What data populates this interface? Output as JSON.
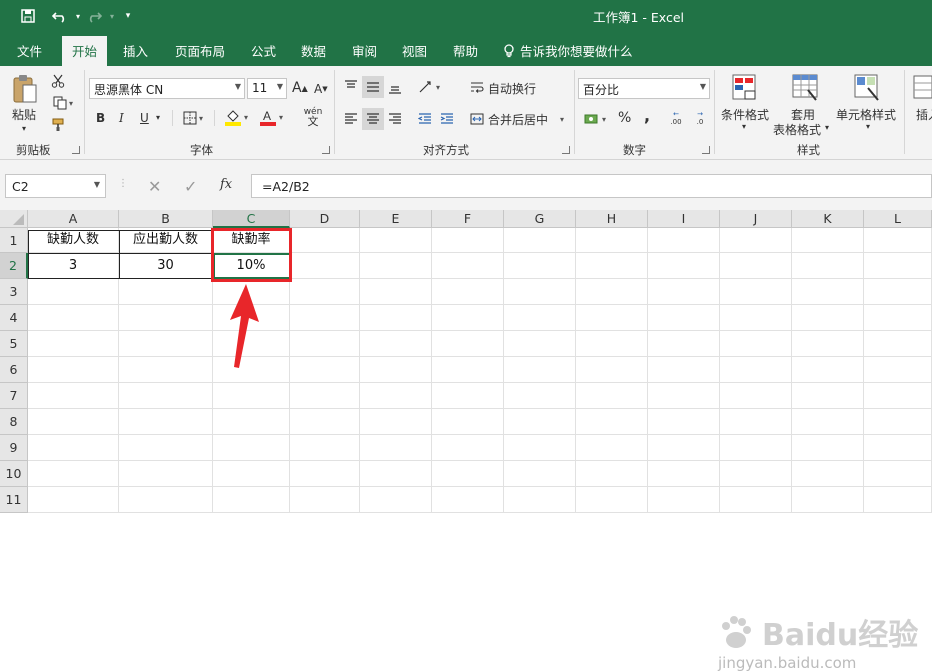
{
  "title": "工作簿1  -  Excel",
  "tabs": [
    "文件",
    "开始",
    "插入",
    "页面布局",
    "公式",
    "数据",
    "审阅",
    "视图",
    "帮助"
  ],
  "active_tab": "开始",
  "tell_me": "告诉我你想要做什么",
  "ribbon": {
    "clipboard": {
      "paste_label": "粘贴",
      "group_label": "剪贴板"
    },
    "font": {
      "font_name": "思源黑体 CN",
      "font_size": "11",
      "bold": "B",
      "italic": "I",
      "underline": "U",
      "grow": "A",
      "shrink": "A",
      "wen": "wén",
      "group_label": "字体"
    },
    "alignment": {
      "wrap_text": "自动换行",
      "merge_center": "合并后居中",
      "group_label": "对齐方式"
    },
    "number": {
      "format": "百分比",
      "percent": "%",
      "comma": ",",
      "inc_decimal": ".00",
      "dec_decimal": ".0",
      "group_label": "数字"
    },
    "styles": {
      "cond_format": "条件格式",
      "table_format_1": "套用",
      "table_format_2": "表格格式",
      "cell_styles": "单元格样式",
      "group_label": "样式"
    },
    "cells": {
      "insert": "插入"
    }
  },
  "formula_bar": {
    "name_box": "C2",
    "fx": "fx",
    "formula": "=A2/B2"
  },
  "columns": [
    "A",
    "B",
    "C",
    "D",
    "E",
    "F",
    "G",
    "H",
    "I",
    "J",
    "K",
    "L"
  ],
  "rows": [
    "1",
    "2",
    "3",
    "4",
    "5",
    "6",
    "7",
    "8",
    "9",
    "10",
    "11"
  ],
  "cells": {
    "A1": "缺勤人数",
    "B1": "应出勤人数",
    "C1": "缺勤率",
    "A2": "3",
    "B2": "30",
    "C2": "10%"
  },
  "selected_cell": "C2",
  "watermark": {
    "brand": "Baidu经验",
    "url": "jingyan.baidu.com"
  },
  "colors": {
    "excel_green": "#217346",
    "highlight_red": "#e8262a",
    "fill_yellow": "#ffe800",
    "font_red": "#e8262a"
  }
}
